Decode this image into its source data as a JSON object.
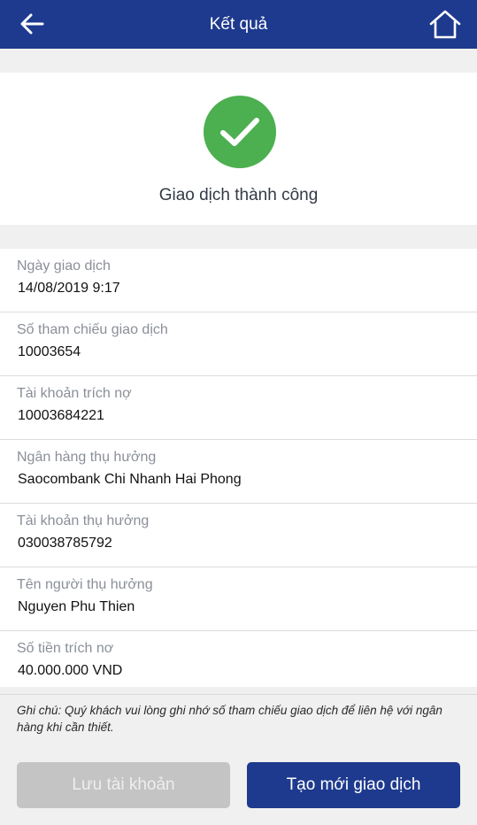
{
  "header": {
    "title": "Kết quả",
    "back_icon": "arrow-left-icon",
    "home_icon": "home-icon"
  },
  "result": {
    "status_icon": "check-circle-icon",
    "message": "Giao dịch thành công"
  },
  "details": [
    {
      "label": "Ngày giao dịch",
      "value": "14/08/2019 9:17"
    },
    {
      "label": "Số tham chiếu giao dịch",
      "value": "10003654"
    },
    {
      "label": "Tài khoản trích nợ",
      "value": "10003684221"
    },
    {
      "label": "Ngân hàng thụ hưởng",
      "value": "Saocombank Chi Nhanh Hai Phong"
    },
    {
      "label": "Tài khoản thụ hưởng",
      "value": "030038785792"
    },
    {
      "label": "Tên người thụ hưởng",
      "value": "Nguyen Phu Thien"
    },
    {
      "label": "Số tiền trích nơ",
      "value": "40.000.000 VND"
    }
  ],
  "note": "Ghi chú: Quý khách vui lòng ghi nhớ số tham chiếu giao dịch để liên hệ với ngân hàng khi cần thiết.",
  "actions": {
    "save_label": "Lưu tài khoản",
    "new_label": "Tạo mới giao dịch"
  },
  "colors": {
    "brand": "#1e3a8e",
    "success": "#4caf50",
    "disabled": "#c4c4c4"
  }
}
